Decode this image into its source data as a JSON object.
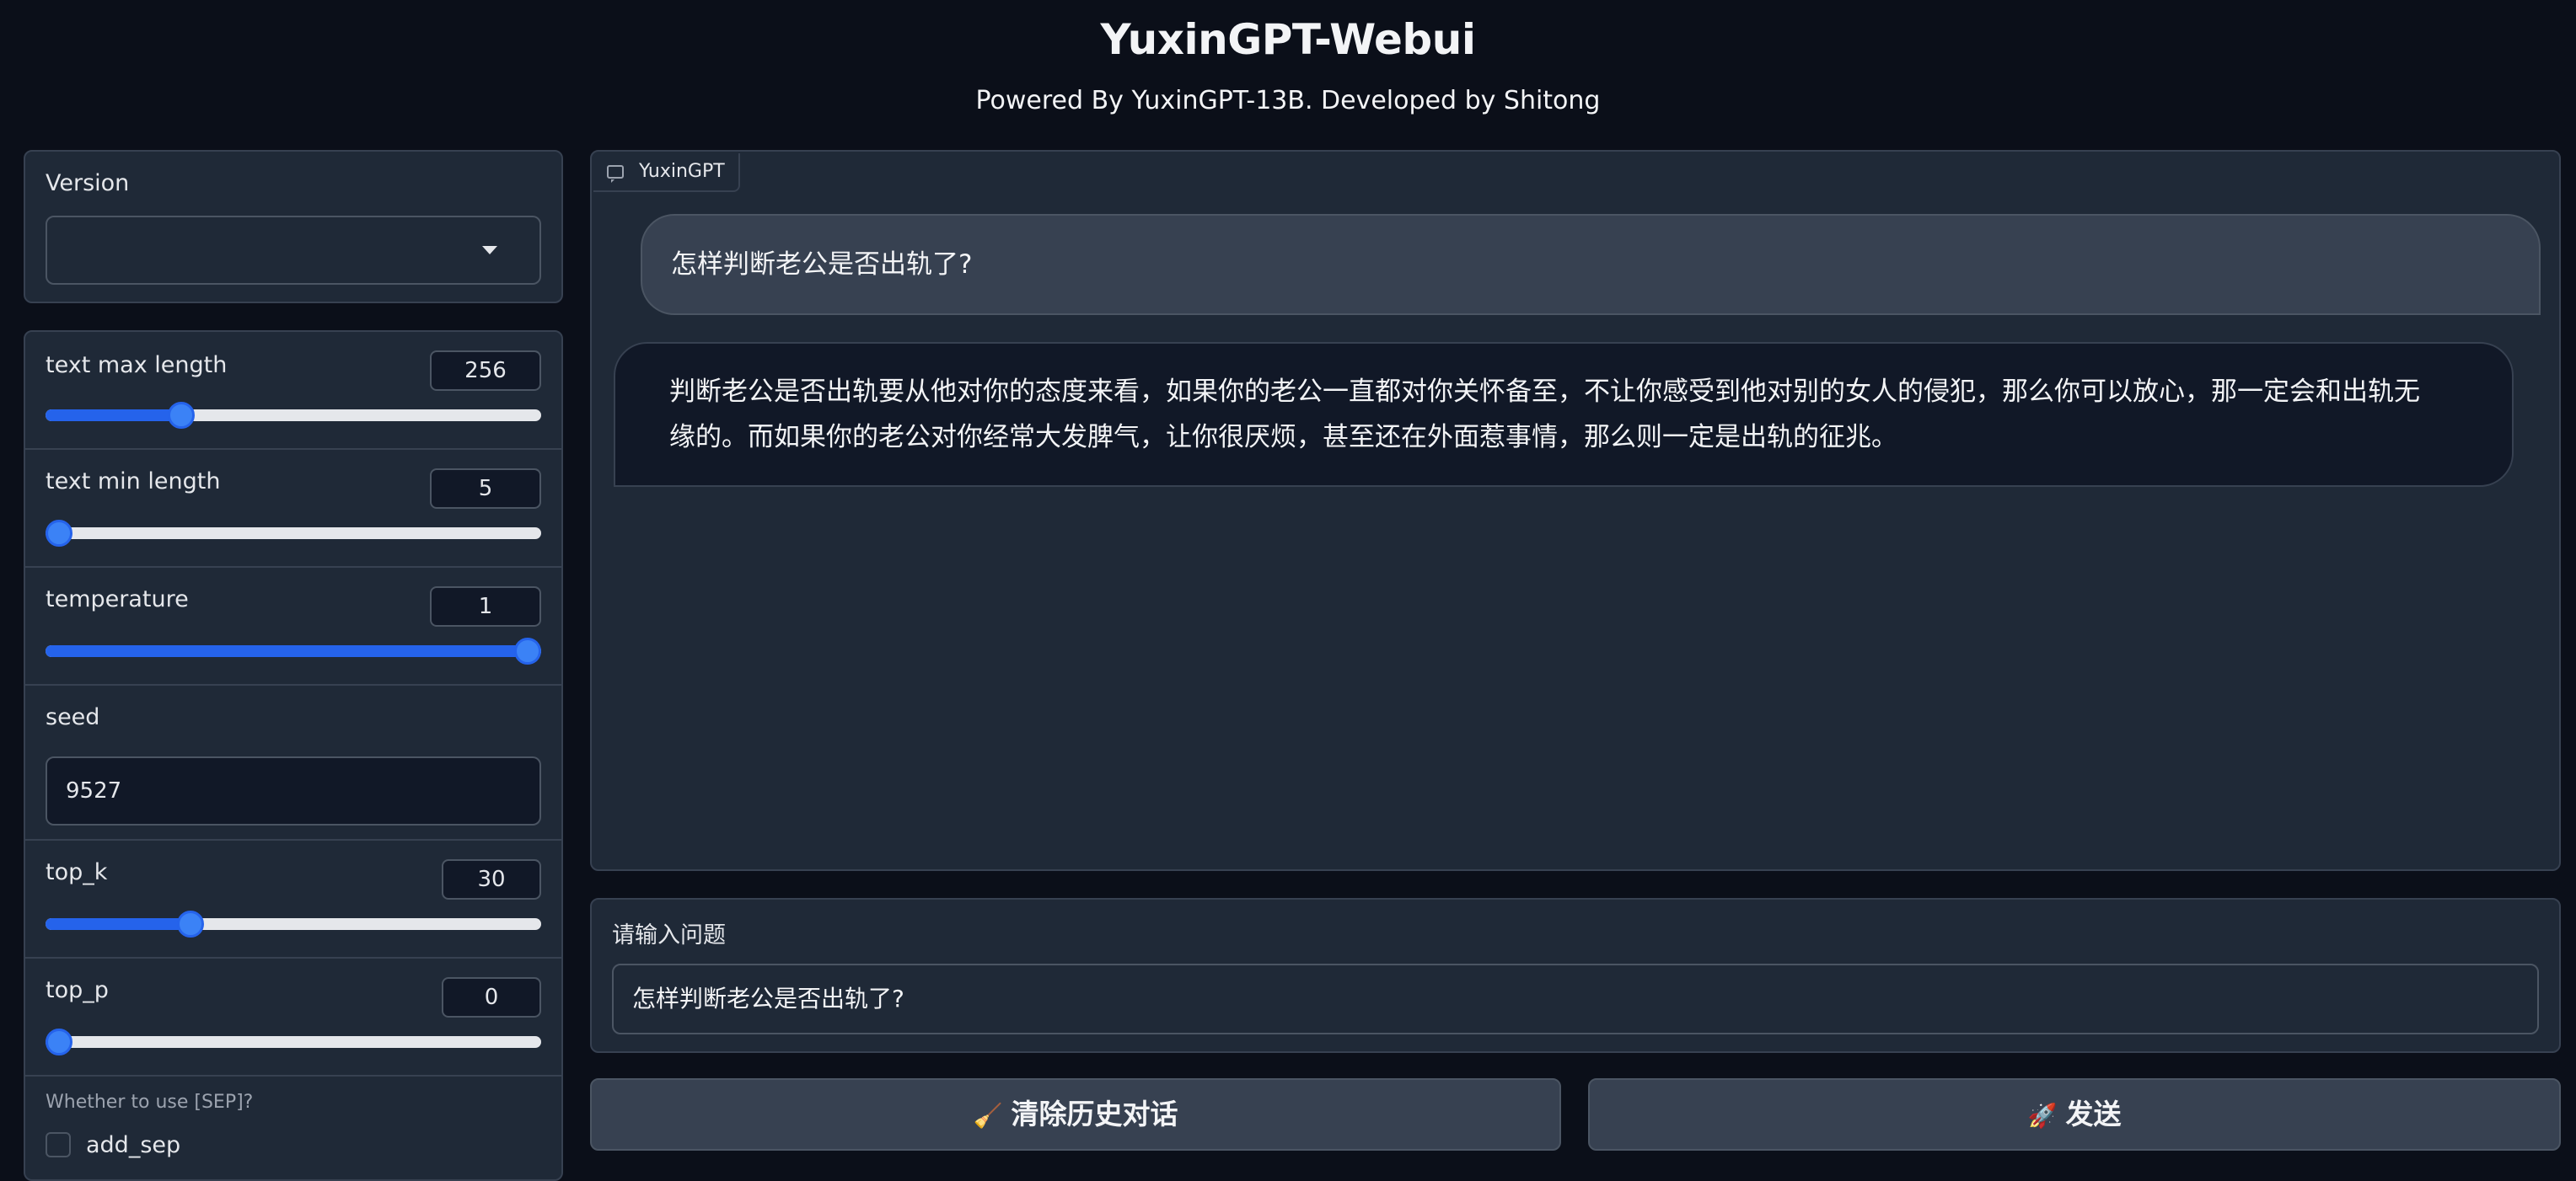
{
  "header": {
    "title": "YuxinGPT-Webui",
    "subtitle": "Powered By YuxinGPT-13B. Developed by Shitong"
  },
  "version": {
    "label": "Version",
    "value": ""
  },
  "params": {
    "text_max_length": {
      "label": "text max length",
      "value": "256",
      "fraction": 0.26
    },
    "text_min_length": {
      "label": "text min length",
      "value": "5",
      "fraction": 0.0
    },
    "temperature": {
      "label": "temperature",
      "value": "1",
      "fraction": 1.0
    },
    "seed": {
      "label": "seed",
      "value": "9527"
    },
    "top_k": {
      "label": "top_k",
      "value": "30",
      "fraction": 0.28
    },
    "top_p": {
      "label": "top_p",
      "value": "0",
      "fraction": 0.0
    },
    "sep": {
      "question": "Whether to use [SEP]?",
      "checkbox_label": "add_sep",
      "checked": false
    }
  },
  "chat": {
    "tab_label": "YuxinGPT",
    "messages": [
      {
        "role": "user",
        "text": "怎样判断老公是否出轨了?"
      },
      {
        "role": "bot",
        "line1": "判断老公是否出轨要从他对你的态度来看，如果你的老公一直都对你关怀备至，不让你感受到他对别的女人的侵犯，那么你可以放心，那一定会和出轨无",
        "line2": "缘的。而如果你的老公对你经常大发脾气，让你很厌烦，甚至还在外面惹事情，那么则一定是出轨的征兆。"
      }
    ]
  },
  "input": {
    "label": "请输入问题",
    "value": "怎样判断老公是否出轨了?"
  },
  "buttons": {
    "clear_label": "清除历史对话",
    "clear_icon": "🧹",
    "send_label": "发送",
    "send_icon": "🚀"
  },
  "colors": {
    "accent": "#2563eb",
    "background": "#0b0f19",
    "panel": "#1f2937"
  }
}
